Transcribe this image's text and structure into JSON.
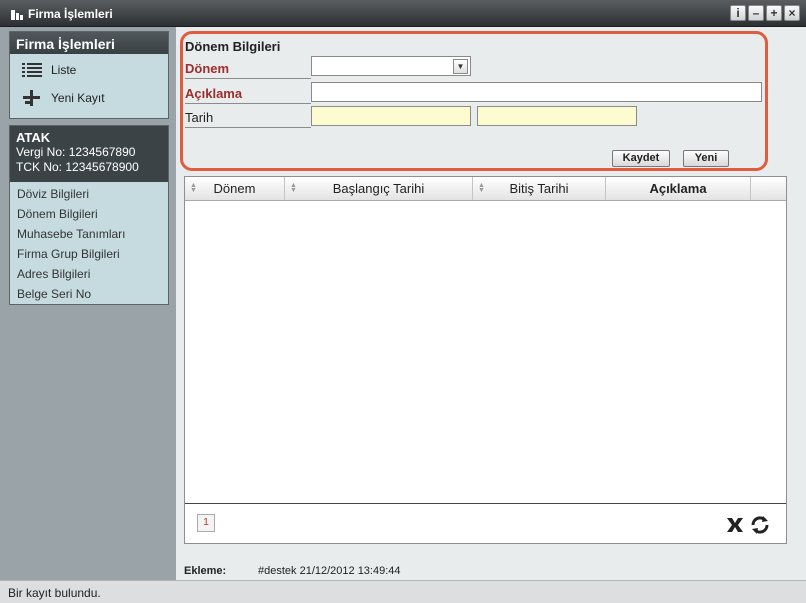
{
  "window": {
    "title": "Firma İşlemleri",
    "buttons": [
      "i",
      "–",
      "+",
      "×"
    ]
  },
  "sidebar": {
    "menu_title": "Firma İşlemleri",
    "menu_items": [
      {
        "label": "Liste",
        "icon": "list-icon"
      },
      {
        "label": "Yeni Kayıt",
        "icon": "new-record-icon"
      }
    ],
    "company": {
      "name": "ATAK",
      "tax_no": "Vergi No: 1234567890",
      "tck_no": "TCK No: 12345678900"
    },
    "links": [
      "Döviz Bilgileri",
      "Dönem Bilgileri",
      "Muhasebe Tanımları",
      "Firma Grup Bilgileri",
      "Adres Bilgileri",
      "Belge Seri No"
    ]
  },
  "form": {
    "title": "Dönem Bilgileri",
    "donem_label": "Dönem",
    "donem_value": "",
    "aciklama_label": "Açıklama",
    "aciklama_value": "",
    "tarih_label": "Tarih",
    "tarih_start": "",
    "tarih_end": "",
    "save_label": "Kaydet",
    "new_label": "Yeni",
    "highlight_color": "#e05c3e",
    "date_field_color": "#fdfcd0"
  },
  "grid": {
    "columns": [
      "Dönem",
      "Başlangıç Tarihi",
      "Bitiş Tarihi",
      "Açıklama"
    ],
    "rows": [],
    "page": "1"
  },
  "audit": {
    "label": "Ekleme:",
    "value": "#destek 21/12/2012 13:49:44"
  },
  "status": {
    "text": "Bir kayıt bulundu."
  }
}
